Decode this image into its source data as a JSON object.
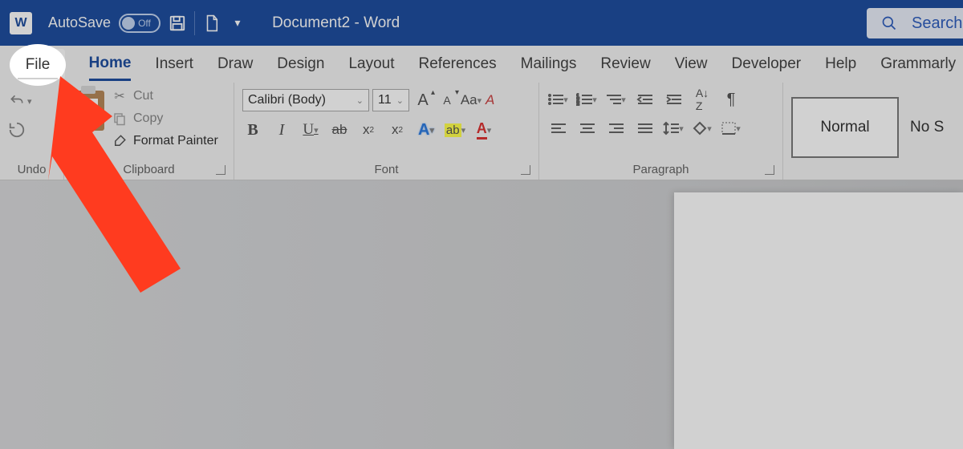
{
  "titlebar": {
    "autosave_label": "AutoSave",
    "autosave_state": "Off",
    "doc_title": "Document2  -  Word",
    "search_placeholder": "Search"
  },
  "tabs": {
    "file": "File",
    "home": "Home",
    "insert": "Insert",
    "draw": "Draw",
    "design": "Design",
    "layout": "Layout",
    "references": "References",
    "mailings": "Mailings",
    "review": "Review",
    "view": "View",
    "developer": "Developer",
    "help": "Help",
    "grammarly": "Grammarly"
  },
  "ribbon": {
    "undo": {
      "label": "Undo"
    },
    "clipboard": {
      "label": "Clipboard",
      "cut": "Cut",
      "copy": "Copy",
      "format_painter": "Format Painter"
    },
    "font": {
      "label": "Font",
      "name": "Calibri (Body)",
      "size": "11"
    },
    "paragraph": {
      "label": "Paragraph"
    },
    "styles": {
      "normal": "Normal",
      "nospacing": "No S"
    }
  },
  "spotlight_tab": "File"
}
